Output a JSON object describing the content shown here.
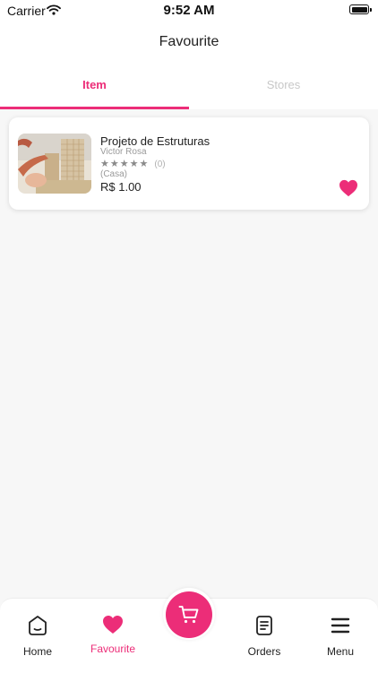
{
  "status_bar": {
    "carrier": "Carrier",
    "time": "9:52 AM"
  },
  "header": {
    "title": "Favourite"
  },
  "tabs": [
    {
      "label": "Item",
      "active": true
    },
    {
      "label": "Stores",
      "active": false
    }
  ],
  "favourites": [
    {
      "title": "Projeto de Estruturas",
      "seller": "Victor Rosa",
      "rating_stars": 0,
      "rating_count": "(0)",
      "category": "(Casa)",
      "price": "R$ 1.00",
      "favourited": true
    }
  ],
  "bottom_nav": {
    "items": [
      {
        "label": "Home",
        "icon": "home-icon"
      },
      {
        "label": "Favourite",
        "icon": "heart-icon",
        "active": true
      },
      {
        "label": "Orders",
        "icon": "orders-icon"
      },
      {
        "label": "Menu",
        "icon": "menu-icon"
      }
    ],
    "center_button_icon": "cart-icon"
  },
  "colors": {
    "accent": "#ec2d78",
    "background": "#f7f7f7",
    "inactive_tab": "#c8c8c8"
  }
}
